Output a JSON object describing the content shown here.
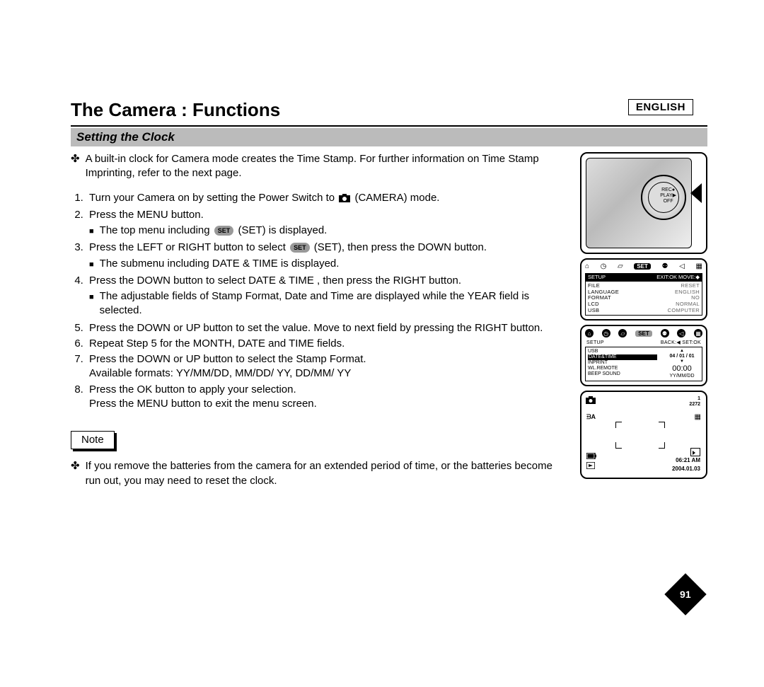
{
  "language_tag": "ENGLISH",
  "title": "The Camera : Functions",
  "section_heading": "Setting the Clock",
  "intro_bullet": "A built-in clock for Camera mode creates the Time Stamp. For further information on Time Stamp Imprinting, refer to the next page.",
  "set_pill": "SET",
  "steps": {
    "s1": "Turn your Camera on by setting the Power Switch to ",
    "s1b": "(CAMERA) mode.",
    "s2": "Press the MENU button.",
    "s2_sub": "The top menu including ",
    "s2_sub_b": " (SET) is displayed.",
    "s3": "Press the LEFT or RIGHT button to select ",
    "s3b": " (SET), then press the DOWN button.",
    "s3_sub": "The submenu including  DATE & TIME  is displayed.",
    "s4": "Press the DOWN button to select  DATE & TIME , then press the RIGHT button.",
    "s4_sub": "The adjustable fields of Stamp Format, Date and Time are displayed while the YEAR field is selected.",
    "s5": "Press the DOWN or UP button to set the value. Move to next field by pressing the RIGHT button.",
    "s6": "Repeat Step 5 for the MONTH, DATE and TIME fields.",
    "s7a": "Press the DOWN or UP button to select the Stamp Format.",
    "s7b": "Available formats:  YY/MM/DD, MM/DD/ YY, DD/MM/ YY",
    "s8a": "Press the OK button to apply your selection.",
    "s8b": "Press the MENU button to exit the menu screen."
  },
  "note_label": "Note",
  "note_text": "If you remove the batteries from the camera for an extended period of time, or the batteries become run out, you may need to reset the clock.",
  "dial_labels": "REC●\nPLAY▶\nOFF",
  "screen1": {
    "top_set": "SET",
    "header_left": "SETUP",
    "header_right": "EXIT:OK  MOVE:◆",
    "rows": [
      [
        "FILE",
        "RESET"
      ],
      [
        "LANGUAGE",
        "ENGLISH"
      ],
      [
        "FORMAT",
        "NO"
      ],
      [
        "LCD",
        "NORMAL"
      ],
      [
        "USB",
        "COMPUTER"
      ]
    ]
  },
  "screen2": {
    "top_set": "SET",
    "header_left": "SETUP",
    "header_right": "BACK:◀   SET:OK",
    "left_items": [
      "USB",
      "DATE&TIME",
      "INPRINT",
      "WL.REMOTE",
      "BEEP SOUND"
    ],
    "right_date": "04 / 01 / 01",
    "right_time": "00:00",
    "right_fmt": "YY/MM/DD"
  },
  "screen3": {
    "count": "1",
    "res": "2272",
    "flash": "ᗲA",
    "time": "06:21 AM",
    "date": "2004.01.03"
  },
  "page_number": "91"
}
